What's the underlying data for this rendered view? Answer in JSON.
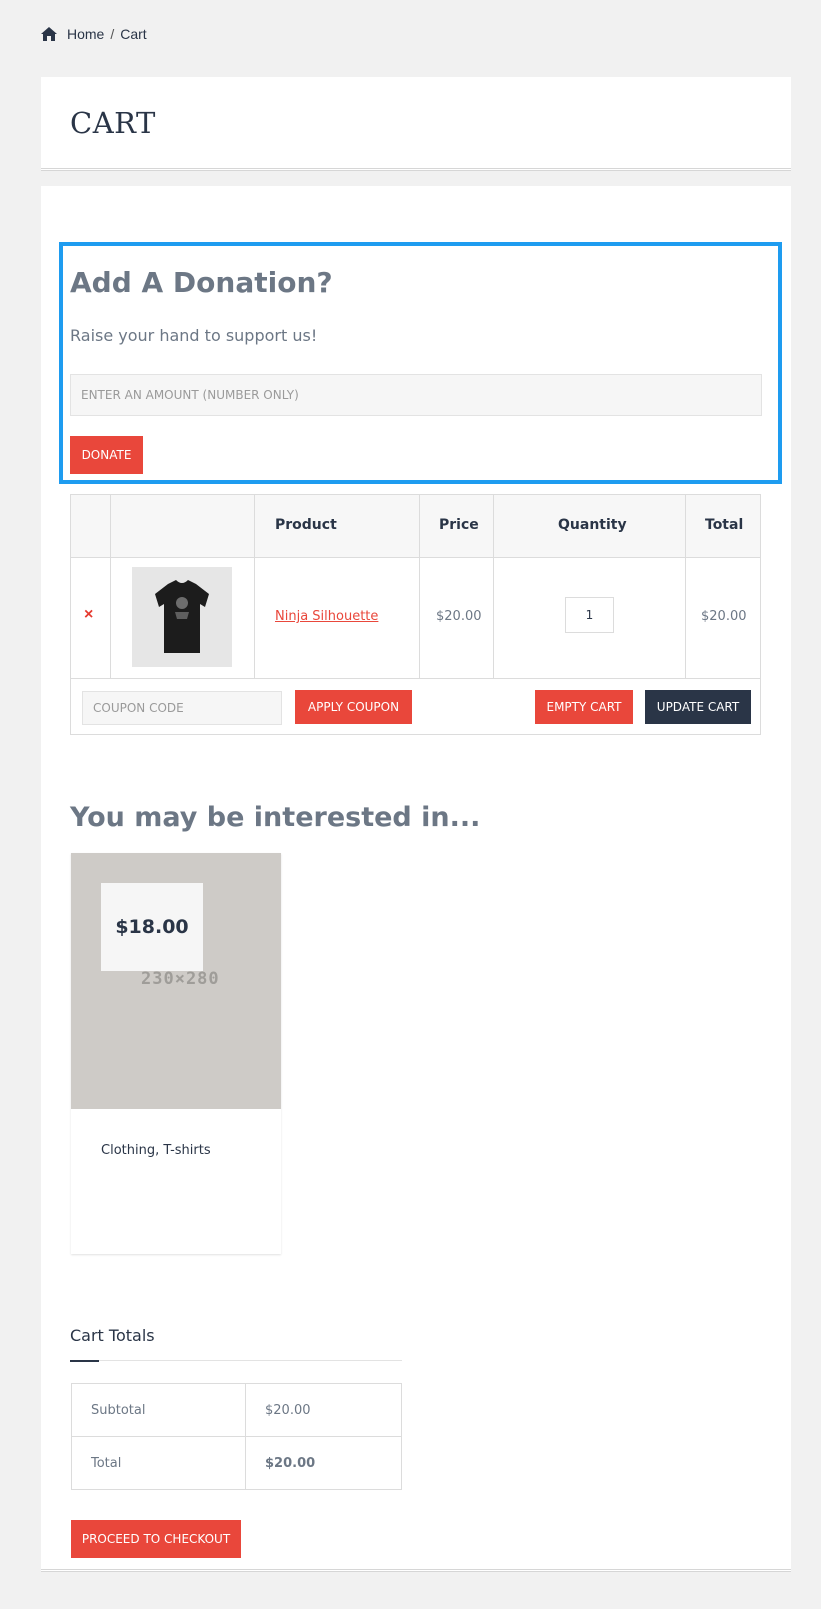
{
  "breadcrumb": {
    "home": "Home",
    "separator": "/",
    "current": "Cart"
  },
  "page_title": "CART",
  "donation": {
    "title": "Add A Donation?",
    "text": "Raise your hand to support us!",
    "amount_placeholder": "ENTER AN AMOUNT (NUMBER ONLY)",
    "donate_label": "DONATE",
    "highlight_color": "#1e9cf0"
  },
  "cart": {
    "headers": {
      "product": "Product",
      "price": "Price",
      "quantity": "Quantity",
      "total": "Total"
    },
    "items": [
      {
        "remove": "×",
        "name": "Ninja Silhouette",
        "price": "$20.00",
        "quantity": "1",
        "total": "$20.00"
      }
    ],
    "coupon_placeholder": "COUPON CODE",
    "apply_coupon": "APPLY COUPON",
    "empty_cart": "EMPTY CART",
    "update_cart": "UPDATE CART"
  },
  "interested": {
    "title": "You may be interested in...",
    "products": [
      {
        "price": "$18.00",
        "image_text": "230×280",
        "categories": "Clothing, T-shirts"
      }
    ]
  },
  "totals": {
    "title": "Cart Totals",
    "subtotal_label": "Subtotal",
    "subtotal_value": "$20.00",
    "total_label": "Total",
    "total_value": "$20.00",
    "checkout": "PROCEED TO CHECKOUT"
  },
  "colors": {
    "accent_red": "#e9473b",
    "dark_navy": "#2a3547",
    "text_gray": "#6c7785"
  }
}
